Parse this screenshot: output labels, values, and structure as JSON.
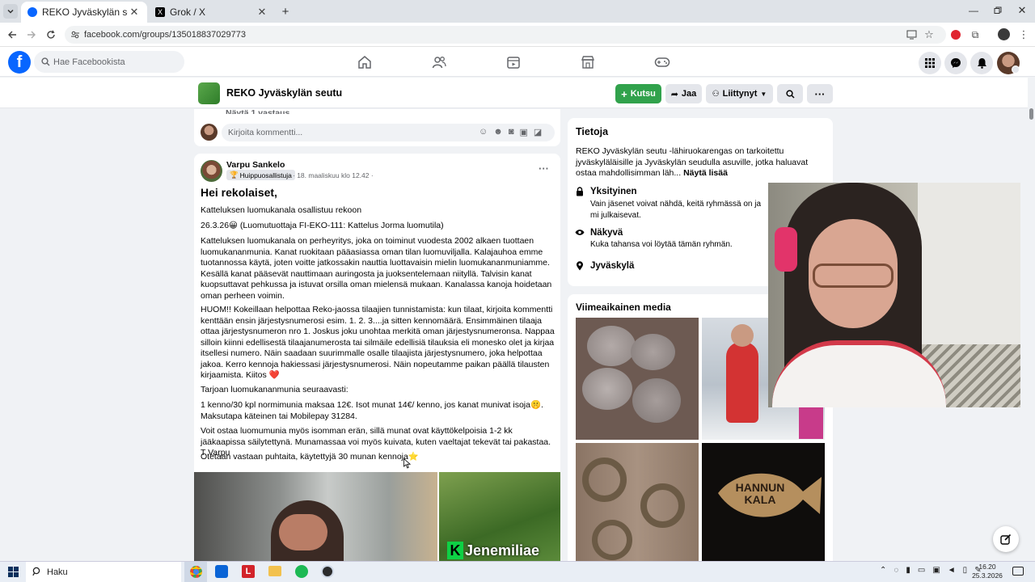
{
  "browser": {
    "tabs": [
      {
        "title": "REKO Jyväskylän seutu | Facebo"
      },
      {
        "title": "Grok / X"
      }
    ],
    "url": "facebook.com/groups/135018837029773"
  },
  "header": {
    "search_placeholder": "Hae Facebookista"
  },
  "group": {
    "name": "REKO Jyväskylän seutu",
    "buttons": {
      "invite": "Kutsu",
      "share": "Jaa",
      "joined": "Liittynyt"
    }
  },
  "prev_post": {
    "see_reply": "Näytä 1 vastaus",
    "comment_placeholder": "Kirjoita kommentti..."
  },
  "post": {
    "author": "Varpu Sankelo",
    "badge": "Huippuosallistuja",
    "timestamp": "· 18. maaliskuu klo 12.42 ·",
    "title": "Hei rekolaiset,",
    "paragraphs": [
      "Katteluksen luomukanala osallistuu rekoon",
      "26.3.26😀 (Luomutuottaja FI-EKO-111: Kattelus Jorma luomutila)",
      "Katteluksen luomukanala on perheyritys, joka on toiminut vuodesta 2002 alkaen tuottaen luomukananmunia. Kanat ruokitaan pääasiassa oman tilan luomuviljalla. Kalajauhoa emme tuotannossa käytä, joten voitte jatkossakin nauttia luottavaisin mielin luomukananmuniamme. Kesällä kanat pääsevät nauttimaan auringosta ja juoksentelemaan niityllä. Talvisin kanat kuopsuttavat pehkussa ja istuvat orsilla oman mielensä mukaan. Kanalassa kanoja hoidetaan oman perheen voimin.",
      "HUOM!! Kokeillaan helpottaa Reko-jaossa tilaajien tunnistamista: kun tilaat, kirjoita kommentti kenttään ensin järjestysnumerosi esim. 1. 2. 3....ja sitten kennomäärä. Ensimmäinen tilaaja ottaa järjestysnumeron nro 1. Joskus joku unohtaa merkitä oman järjestysnumeronsa. Nappaa silloin kiinni edellisestä tilaajanumerosta tai silmäile edellisiä tilauksia eli monesko olet ja kirjaa itsellesi numero. Näin saadaan suurimmalle osalle tilaajista järjestysnumero, joka helpottaa jakoa. Kerro kennoja hakiessasi järjestysnumerosi. Näin nopeutamme paikan päällä tilausten kirjaamista. Kiitos ❤️",
      "Tarjoan luomukananmunia seuraavasti:",
      "1 kenno/30 kpl normimunia maksaa 12€. Isot munat 14€/ kenno, jos kanat munivat isoja🤫. Maksutapa käteinen tai Mobilepay 31284.",
      "Voit ostaa luomumunia myös isomman erän, sillä munat ovat käyttökelpoisia 1-2 kk jääkaapissa säilytettynä. Munamassaa voi myös kuivata, kuten vaeltajat tekevät tai pakastaa. T Varpu",
      "Otetaan vastaan puhtaita, käytettyjä 30 munan kennoja⭐"
    ],
    "image_overlay_text": "Jenemiliae"
  },
  "sidebar": {
    "about_title": "Tietoja",
    "about_text": "REKO Jyväskylän seutu -lähiruokarengas on tarkoitettu jyväskyläläisille ja Jyväskylän seudulla asuville, jotka haluavat ostaa mahdollisimman läh...",
    "see_more": "Näytä lisää",
    "private_title": "Yksityinen",
    "private_desc": "Vain jäsenet voivat nähdä, keitä ryhmässä on ja mi julkaisevat.",
    "visible_title": "Näkyvä",
    "visible_desc": "Kuka tahansa voi löytää tämän ryhmän.",
    "location": "Jyväskylä",
    "media_title": "Viimeaikainen media",
    "media_sign_text": "HANNUN KALA"
  },
  "taskbar": {
    "search": "Haku",
    "time": "16.20",
    "date": "25.3.2026"
  },
  "colors": {
    "fb_blue": "#0866ff",
    "invite_green": "#31a24c",
    "page_bg": "#f0f2f5"
  }
}
